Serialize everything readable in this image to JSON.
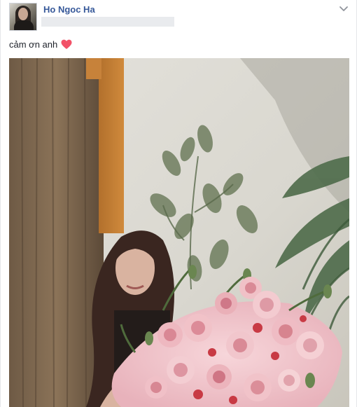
{
  "post": {
    "author_name": "Ho Ngoc Ha",
    "caption": "cảm ơn anh",
    "icons": {
      "avatar": "profile-avatar",
      "options": "chevron-down-icon",
      "emoji": "heart-icon"
    },
    "colors": {
      "author_link": "#365899",
      "text": "#1d2129",
      "heart": "#f25268"
    }
  }
}
